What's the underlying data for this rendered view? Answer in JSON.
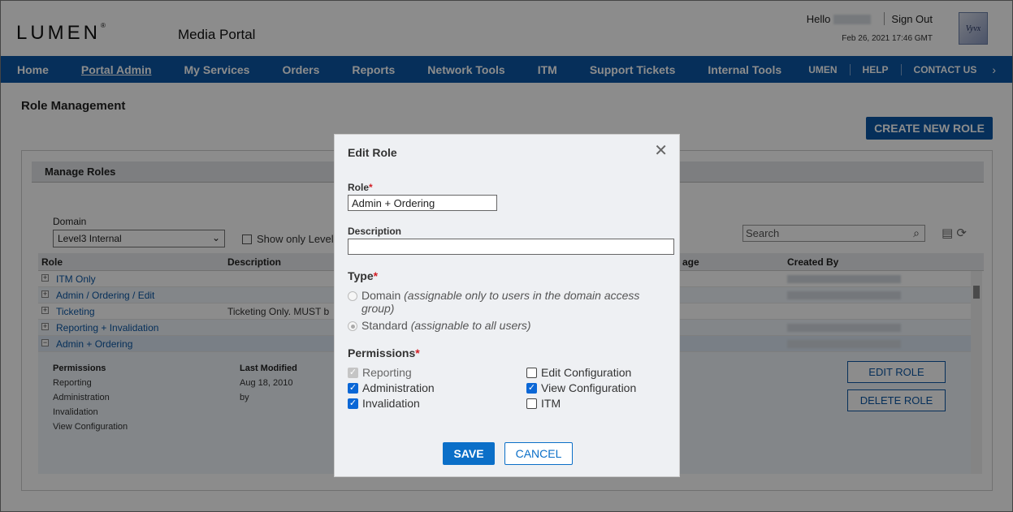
{
  "header": {
    "logo": "LUMEN",
    "portal_name": "Media Portal",
    "hello": "Hello",
    "sign_out": "Sign Out",
    "datetime": "Feb 26, 2021 17:46 GMT",
    "partner_logo": "Vyvx"
  },
  "nav": {
    "items": [
      "Home",
      "Portal Admin",
      "My Services",
      "Orders",
      "Reports",
      "Network Tools",
      "ITM",
      "Support Tickets",
      "Internal Tools"
    ],
    "right": [
      "UMEN",
      "HELP",
      "CONTACT US"
    ],
    "active": "Portal Admin"
  },
  "page": {
    "title": "Role Management",
    "create_button": "CREATE NEW ROLE",
    "panel_title": "Manage Roles",
    "domain_label": "Domain",
    "domain_value": "Level3 Internal",
    "show_only_label": "Show only Level",
    "search_placeholder": "Search",
    "columns": [
      "Role",
      "Description",
      "age",
      "Created By"
    ],
    "rows": [
      {
        "name": "ITM Only",
        "desc": ""
      },
      {
        "name": "Admin / Ordering / Edit",
        "desc": ""
      },
      {
        "name": "Ticketing",
        "desc": "Ticketing Only. MUST b"
      },
      {
        "name": "Reporting + Invalidation",
        "desc": ""
      },
      {
        "name": "Admin + Ordering",
        "desc": ""
      }
    ],
    "detail": {
      "permissions_label": "Permissions",
      "permissions": [
        "Reporting",
        "Administration",
        "Invalidation",
        "View Configuration"
      ],
      "last_modified_label": "Last Modified",
      "last_modified_date": "Aug 18, 2010",
      "by_label": "by",
      "edit_button": "EDIT ROLE",
      "delete_button": "DELETE ROLE"
    }
  },
  "modal": {
    "title": "Edit Role",
    "role_label": "Role",
    "role_value": "Admin + Ordering",
    "description_label": "Description",
    "description_value": "",
    "type_label": "Type",
    "type_domain": "Domain",
    "type_domain_note": "(assignable only to users in the domain access group)",
    "type_standard": "Standard",
    "type_standard_note": "(assignable to all users)",
    "permissions_label": "Permissions",
    "perm_reporting": "Reporting",
    "perm_administration": "Administration",
    "perm_invalidation": "Invalidation",
    "perm_edit_config": "Edit Configuration",
    "perm_view_config": "View Configuration",
    "perm_itm": "ITM",
    "save": "SAVE",
    "cancel": "CANCEL",
    "required_mark": "*"
  }
}
